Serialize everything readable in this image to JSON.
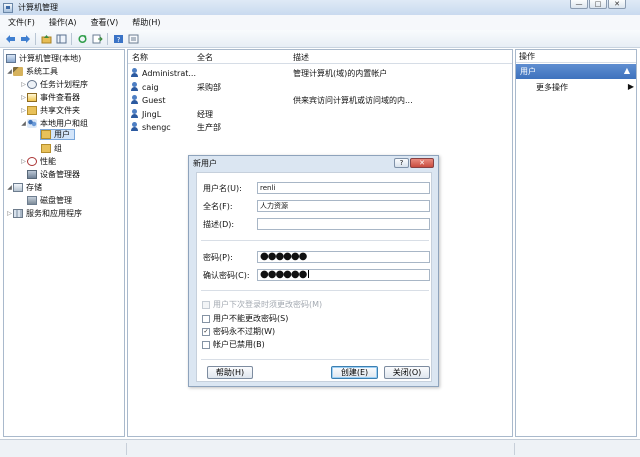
{
  "window": {
    "title": "计算机管理",
    "buttons": [
      "—",
      "□",
      "✕"
    ]
  },
  "menu": {
    "items": [
      "文件(F)",
      "操作(A)",
      "查看(V)",
      "帮助(H)"
    ]
  },
  "toolbar": {
    "icons": [
      "back-arrow-icon",
      "forward-arrow-icon",
      "folder-up-icon",
      "show-tree-icon",
      "refresh-icon",
      "export-icon",
      "help-icon",
      "properties-icon"
    ]
  },
  "tree": {
    "root": "计算机管理(本地)",
    "system_tools": "系统工具",
    "task_scheduler": "任务计划程序",
    "event_viewer": "事件查看器",
    "shared_folders": "共享文件夹",
    "local_users_groups": "本地用户和组",
    "users": "用户",
    "groups": "组",
    "performance": "性能",
    "device_manager": "设备管理器",
    "storage": "存储",
    "disk_management": "磁盘管理",
    "services_apps": "服务和应用程序"
  },
  "list": {
    "headers": {
      "name": "名称",
      "fullname": "全名",
      "description": "描述"
    },
    "rows": [
      {
        "name": "Administrat...",
        "fullname": "",
        "description": "管理计算机(域)的内置帐户"
      },
      {
        "name": "caig",
        "fullname": "采购部",
        "description": ""
      },
      {
        "name": "Guest",
        "fullname": "",
        "description": "供来宾访问计算机或访问域的内..."
      },
      {
        "name": "JingL",
        "fullname": "经理",
        "description": ""
      },
      {
        "name": "shengc",
        "fullname": "生产部",
        "description": ""
      }
    ]
  },
  "actions": {
    "header": "操作",
    "section": "用户",
    "section_arrow": "▲",
    "more": "更多操作",
    "more_arrow": "▶"
  },
  "dialog": {
    "title": "新用户",
    "help_button": "?",
    "close_button": "✕",
    "username_label": "用户名(U):",
    "username_value": "renli",
    "fullname_label": "全名(F):",
    "fullname_value": "人力资源",
    "description_label": "描述(D):",
    "description_value": "",
    "password_label": "密码(P):",
    "password_value": "●●●●●●",
    "confirm_label": "确认密码(C):",
    "confirm_value": "●●●●●●",
    "options": [
      {
        "label": "用户下次登录时须更改密码(M)",
        "checked": false,
        "disabled": true
      },
      {
        "label": "用户不能更改密码(S)",
        "checked": false,
        "disabled": false
      },
      {
        "label": "密码永不过期(W)",
        "checked": true,
        "disabled": false
      },
      {
        "label": "帐户已禁用(B)",
        "checked": false,
        "disabled": false
      }
    ],
    "help_label": "帮助(H)",
    "create_label": "创建(E)",
    "close_label": "关闭(O)"
  }
}
